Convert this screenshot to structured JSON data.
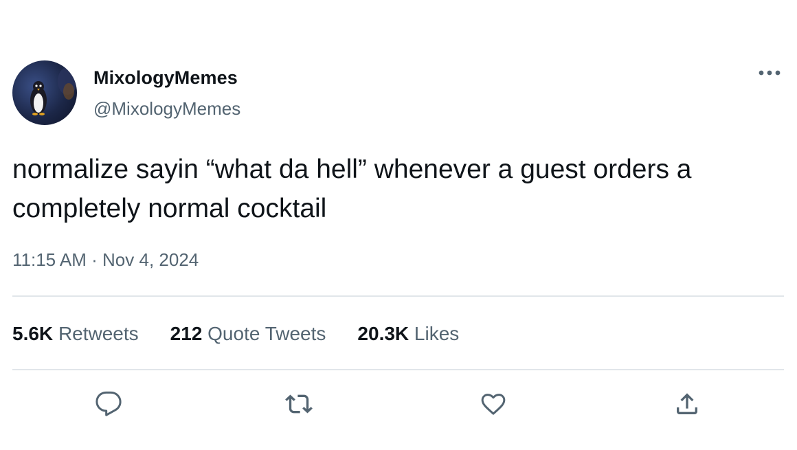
{
  "tweet": {
    "author": {
      "display_name": "MixologyMemes",
      "handle": "@MixologyMemes"
    },
    "text": "normalize sayin “what da hell” whenever a guest orders a completely normal cocktail",
    "timestamp": "11:15 AM · Nov 4, 2024",
    "stats": {
      "retweets_count": "5.6K",
      "retweets_label": "Retweets",
      "quotes_count": "212",
      "quotes_label": "Quote Tweets",
      "likes_count": "20.3K",
      "likes_label": "Likes"
    },
    "actions": {
      "reply_icon": "reply-icon",
      "retweet_icon": "retweet-icon",
      "like_icon": "heart-icon",
      "share_icon": "share-icon",
      "more_icon": "more-icon"
    }
  },
  "colors": {
    "text_primary": "#0f1419",
    "text_secondary": "#536471",
    "divider": "#e1e6ea",
    "icon": "#536471"
  }
}
